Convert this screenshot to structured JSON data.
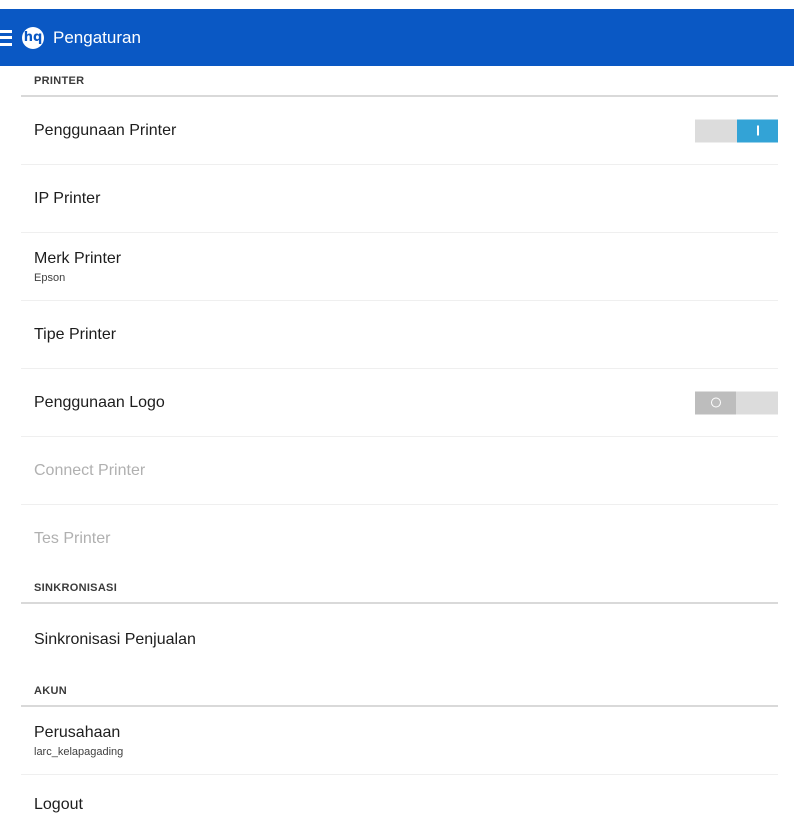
{
  "actionbar": {
    "title": "Pengaturan",
    "logo_text": "hq"
  },
  "sections": {
    "printer": {
      "header": "PRINTER",
      "items": [
        {
          "label": "Penggunaan Printer",
          "toggle": "on"
        },
        {
          "label": "IP Printer"
        },
        {
          "label": "Merk Printer",
          "sub": "Epson"
        },
        {
          "label": "Tipe Printer"
        },
        {
          "label": "Penggunaan Logo",
          "toggle": "off"
        },
        {
          "label": "Connect Printer",
          "disabled": true
        },
        {
          "label": "Tes Printer",
          "disabled": true
        }
      ]
    },
    "sync": {
      "header": "SINKRONISASI",
      "items": [
        {
          "label": "Sinkronisasi Penjualan"
        }
      ]
    },
    "account": {
      "header": "AKUN",
      "items": [
        {
          "label": "Perusahaan",
          "sub": "larc_kelapagading"
        },
        {
          "label": "Logout"
        }
      ]
    }
  },
  "colors": {
    "actionbar": "#0a58c4",
    "toggle_on": "#33a3d6",
    "toggle_off": "#bdbdbd"
  }
}
